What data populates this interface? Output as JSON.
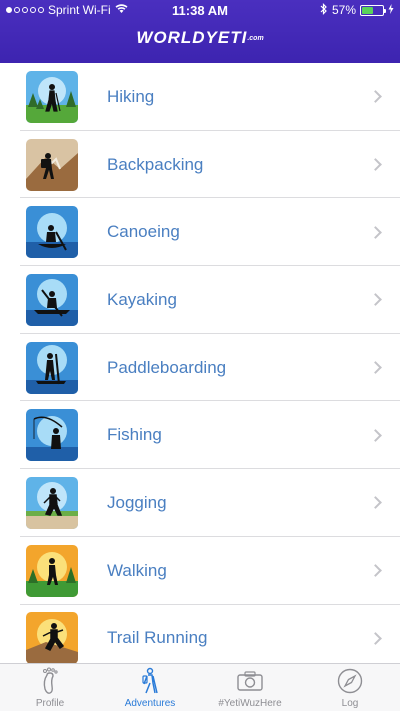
{
  "status_bar": {
    "carrier": "Sprint Wi-Fi",
    "time": "11:38 AM",
    "battery_percent": "57%",
    "battery_level": 0.57,
    "battery_color": "#5ad35a"
  },
  "header": {
    "logo_text": "WORLDYETI",
    "logo_suffix": ".com",
    "background": "#3d24b0"
  },
  "activities": [
    {
      "label": "Hiking",
      "icon": "hiker-icon"
    },
    {
      "label": "Backpacking",
      "icon": "backpacker-icon"
    },
    {
      "label": "Canoeing",
      "icon": "canoe-icon"
    },
    {
      "label": "Kayaking",
      "icon": "kayak-icon"
    },
    {
      "label": "Paddleboarding",
      "icon": "paddleboard-icon"
    },
    {
      "label": "Fishing",
      "icon": "fishing-icon"
    },
    {
      "label": "Jogging",
      "icon": "jogger-icon"
    },
    {
      "label": "Walking",
      "icon": "walker-icon"
    },
    {
      "label": "Trail Running",
      "icon": "trail-runner-icon"
    }
  ],
  "tabs": [
    {
      "label": "Profile",
      "icon": "footprint-icon",
      "active": false
    },
    {
      "label": "Adventures",
      "icon": "hiker-icon",
      "active": true
    },
    {
      "label": "#YetiWuzHere",
      "icon": "camera-icon",
      "active": false
    },
    {
      "label": "Log",
      "icon": "compass-icon",
      "active": false
    }
  ],
  "colors": {
    "label": "#4a7fc1",
    "tab_active": "#2a7bd8",
    "tab_inactive": "#8e8e93"
  }
}
